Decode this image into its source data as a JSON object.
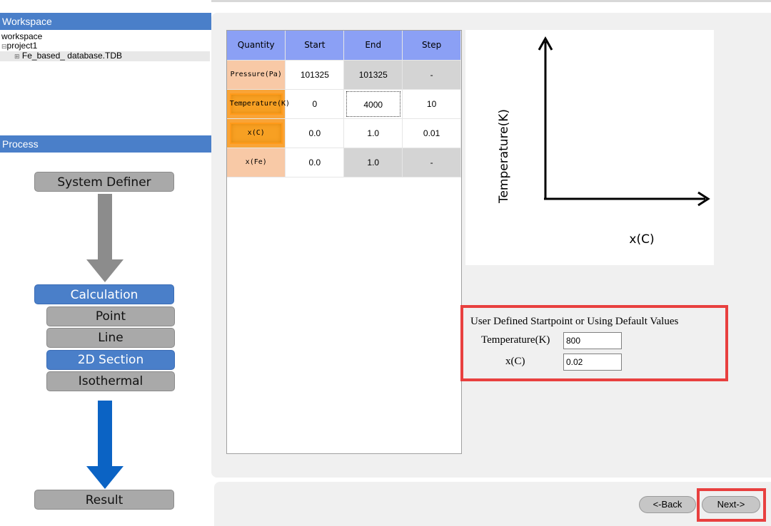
{
  "workspace": {
    "header": "Workspace",
    "tree": {
      "root": "workspace",
      "project": "project1",
      "database": "Fe_based_ database.TDB"
    }
  },
  "process": {
    "header": "Process",
    "steps": {
      "system_definer": "System Definer",
      "calculation": "Calculation",
      "point": "Point",
      "line": "Line",
      "section_2d": "2D Section",
      "isothermal": "Isothermal",
      "result": "Result"
    }
  },
  "table": {
    "headers": [
      "Quantity",
      "Start",
      "End",
      "Step"
    ],
    "rows": [
      [
        "Pressure(Pa)",
        "101325",
        "101325",
        "-"
      ],
      [
        "Temperature(K)",
        "0",
        "4000",
        "10"
      ],
      [
        "x(C)",
        "0.0",
        "1.0",
        "0.01"
      ],
      [
        "x(Fe)",
        "0.0",
        "1.0",
        "-"
      ]
    ]
  },
  "axes": {
    "ylabel": "Temperature(K)",
    "xlabel": "x(C)"
  },
  "startpoint": {
    "title": "User Defined Startpoint or Using Default Values",
    "temperature_label": "Temperature(K)",
    "temperature_value": "800",
    "xc_label": "x(C)",
    "xc_value": "0.02"
  },
  "nav": {
    "back": "<-Back",
    "next": "Next->"
  },
  "colors": {
    "accent_blue": "#4a7fc9",
    "header_purple": "#8ba0f5",
    "highlight_orange": "#f7a023",
    "peach": "#f8c9a6",
    "highlight_red": "#e8403f"
  }
}
